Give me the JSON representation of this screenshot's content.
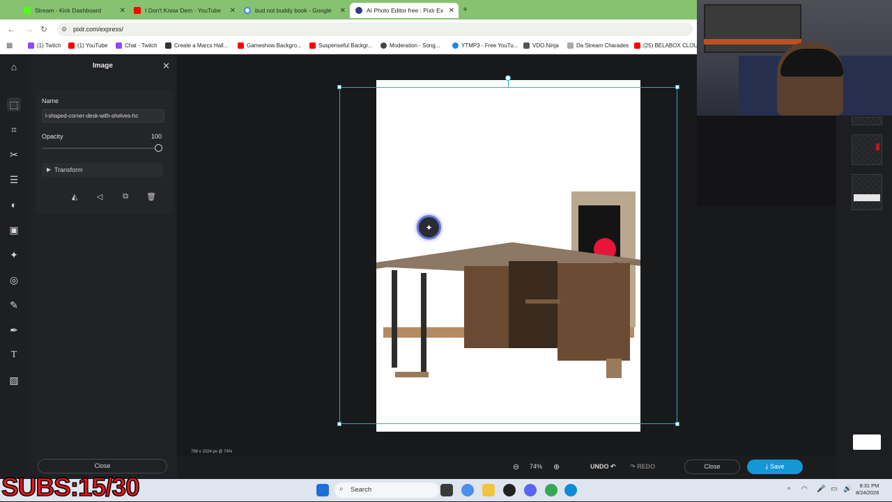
{
  "browser": {
    "tabs": [
      {
        "label": "Stream - Kick Dashboard",
        "color": "#53fc18"
      },
      {
        "label": "I Don't Know Dem - YouTube",
        "color": "#ff0000"
      },
      {
        "label": "bud not buddy book - Google",
        "color": "#4285f4"
      },
      {
        "label": "AI Photo Editor free : Pixlr Expr",
        "color": "#2f3c7e"
      }
    ],
    "new_tab": "+",
    "url": "pixlr.com/express/",
    "bookmarks": [
      {
        "label": "(1) Twitch",
        "color": "#9146ff"
      },
      {
        "label": "(1) YouTube",
        "color": "#ff0000"
      },
      {
        "label": "Chat - Twitch",
        "color": "#9146ff"
      },
      {
        "label": "Create a Marcs Hall...",
        "color": "#333333"
      },
      {
        "label": "Gameshow Backgro...",
        "color": "#ff0000"
      },
      {
        "label": "Suspenseful Backgr...",
        "color": "#ff0000"
      },
      {
        "label": "Moderation - Song...",
        "color": "#444444"
      },
      {
        "label": "YTMP3 - Free YouTu...",
        "color": "#1e88e5"
      },
      {
        "label": "VDO.Ninja",
        "color": "#555555"
      },
      {
        "label": "Da Stream Charades",
        "color": "#777777"
      },
      {
        "label": "(25) BELABOX CLOU...",
        "color": "#ff0000"
      }
    ]
  },
  "panel": {
    "title": "Image",
    "name_label": "Name",
    "name_value": "l-shaped-corner-desk-with-shelves-hc",
    "opacity_label": "Opacity",
    "opacity_value": "100",
    "opacity_fraction": 1.0,
    "transform_label": "Transform",
    "close_label": "Close"
  },
  "editor": {
    "status": "768 x 1024 px @ 74%",
    "zoom": "74%",
    "undo": "UNDO",
    "redo": "REDO",
    "close": "Close",
    "save": "Save"
  },
  "taskbar": {
    "search": "Search",
    "time": "8:31 PM",
    "date": "8/24/2026"
  },
  "overlay": {
    "subs": "SUBS:15/30"
  }
}
